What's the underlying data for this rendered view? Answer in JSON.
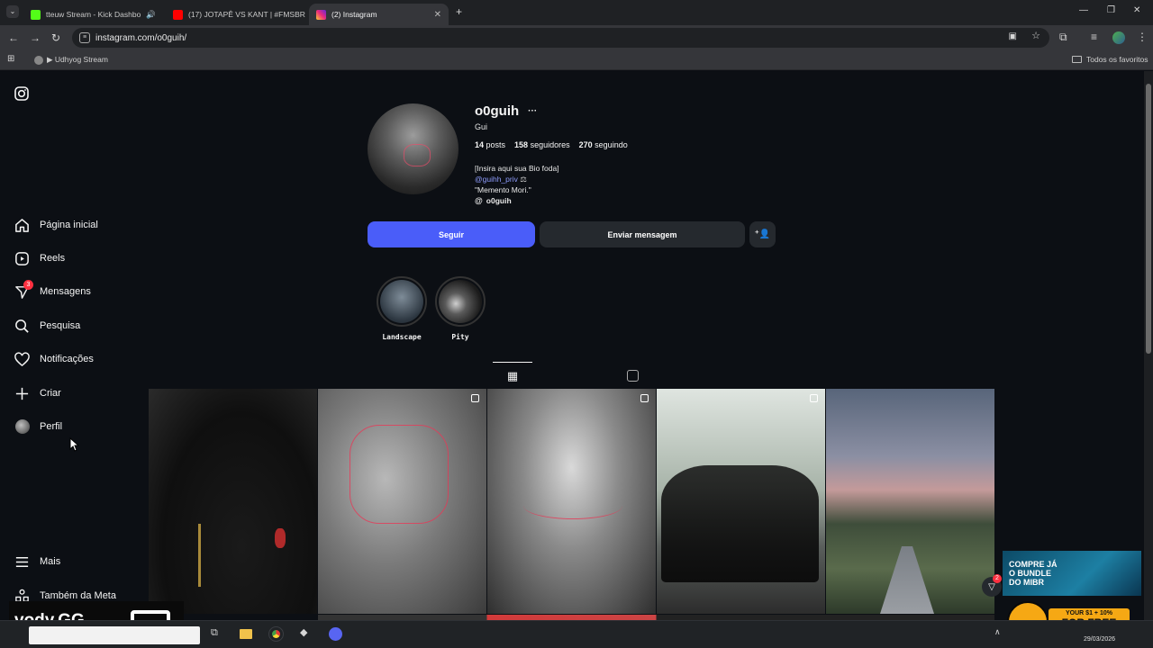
{
  "browser": {
    "tabs": [
      {
        "title": "tteuw Stream - Kick Dashbo",
        "fav_color": "#53fc18"
      },
      {
        "title": "(17) JOTAPÊ VS KANT | #FMSBR",
        "fav_color": "#ff0000"
      },
      {
        "title": "(2) Instagram",
        "fav_color": "#e1306c"
      }
    ],
    "url": "instagram.com/o0guih/",
    "bookmark": "▶ Udhyog Stream",
    "all_favorites": "Todos os favoritos"
  },
  "sidebar": {
    "items": [
      {
        "label": "Página inicial",
        "icon": "home-icon"
      },
      {
        "label": "Reels",
        "icon": "reels-icon"
      },
      {
        "label": "Mensagens",
        "icon": "messenger-icon",
        "badge": "3"
      },
      {
        "label": "Pesquisa",
        "icon": "search-icon"
      },
      {
        "label": "Notificações",
        "icon": "heart-icon"
      },
      {
        "label": "Criar",
        "icon": "plus-icon"
      },
      {
        "label": "Perfil",
        "icon": "avatar-icon"
      }
    ],
    "more": "Mais",
    "meta": "Também da Meta"
  },
  "profile": {
    "username": "o0guih",
    "name": "Gui",
    "posts_count": "14",
    "posts_label": "posts",
    "followers_count": "158",
    "followers_label": "seguidores",
    "following_count": "270",
    "following_label": "seguindo",
    "bio_line1": "[Insira aqui sua Bio foda]",
    "bio_mention": "@guihh_priv",
    "bio_line3": "\"Memento Mori.\"",
    "threads": "o0guih",
    "follow_button": "Seguir",
    "message_button": "Enviar mensagem"
  },
  "highlights": [
    {
      "label": "Landscape"
    },
    {
      "label": "Pity"
    }
  ],
  "overlay": {
    "vody": "vody.GG",
    "ad_line1": "COMPRE JÁ",
    "ad_line2": "O BUNDLE",
    "ad_line3": "DO MIBR",
    "promo1": "YOUR $1 + 10%",
    "promo2": "FOR FREE",
    "messages_badge": "2"
  },
  "taskbar": {
    "date": "29/03/2026"
  },
  "colors": {
    "accent": "#4a5df9",
    "bg": "#0c0f14",
    "badge": "#ff3040"
  }
}
